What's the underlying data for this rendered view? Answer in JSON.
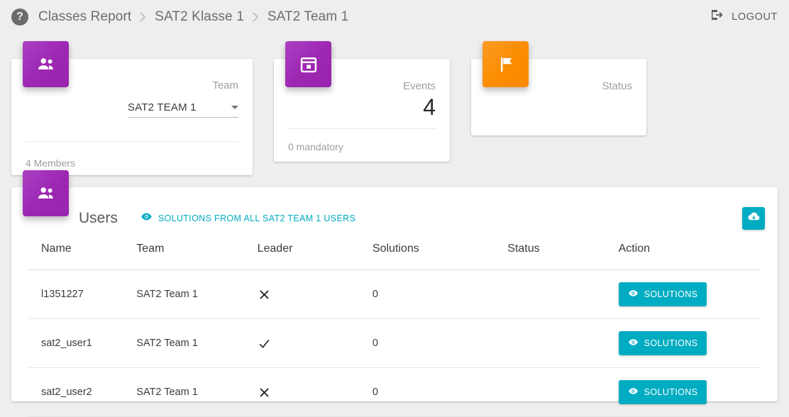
{
  "header": {
    "help_icon": "help-circle-icon",
    "breadcrumb": [
      "Classes Report",
      "SAT2 Klasse 1",
      "SAT2 Team 1"
    ],
    "logout_label": "LOGOUT",
    "logout_icon": "logout-icon"
  },
  "cards": {
    "team": {
      "icon": "people-icon",
      "label": "Team",
      "select_value": "SAT2 TEAM 1",
      "footer": "4 Members"
    },
    "events": {
      "icon": "calendar-icon",
      "label": "Events",
      "value": "4",
      "footer": "0 mandatory"
    },
    "status": {
      "icon": "flag-icon",
      "label": "Status",
      "value": ""
    }
  },
  "users_panel": {
    "icon": "people-icon",
    "title": "Users",
    "solutions_link_label": "SOLUTIONS FROM ALL SAT2 TEAM 1 USERS",
    "solutions_link_icon": "eye-icon",
    "download_icon": "cloud-download-icon",
    "columns": [
      "Name",
      "Team",
      "Leader",
      "Solutions",
      "Status",
      "Action"
    ],
    "rows": [
      {
        "name": "l1351227",
        "team": "SAT2 Team 1",
        "leader": "x",
        "solutions": "0",
        "status": "",
        "action_label": "SOLUTIONS"
      },
      {
        "name": "sat2_user1",
        "team": "SAT2 Team 1",
        "leader": "check",
        "solutions": "0",
        "status": "",
        "action_label": "SOLUTIONS"
      },
      {
        "name": "sat2_user2",
        "team": "SAT2 Team 1",
        "leader": "x",
        "solutions": "0",
        "status": "",
        "action_label": "SOLUTIONS"
      }
    ]
  },
  "colors": {
    "accent_purple": "#9c27b0",
    "accent_orange": "#fb8c00",
    "accent_teal": "#00acc1",
    "page_background": "#eeeeee"
  }
}
